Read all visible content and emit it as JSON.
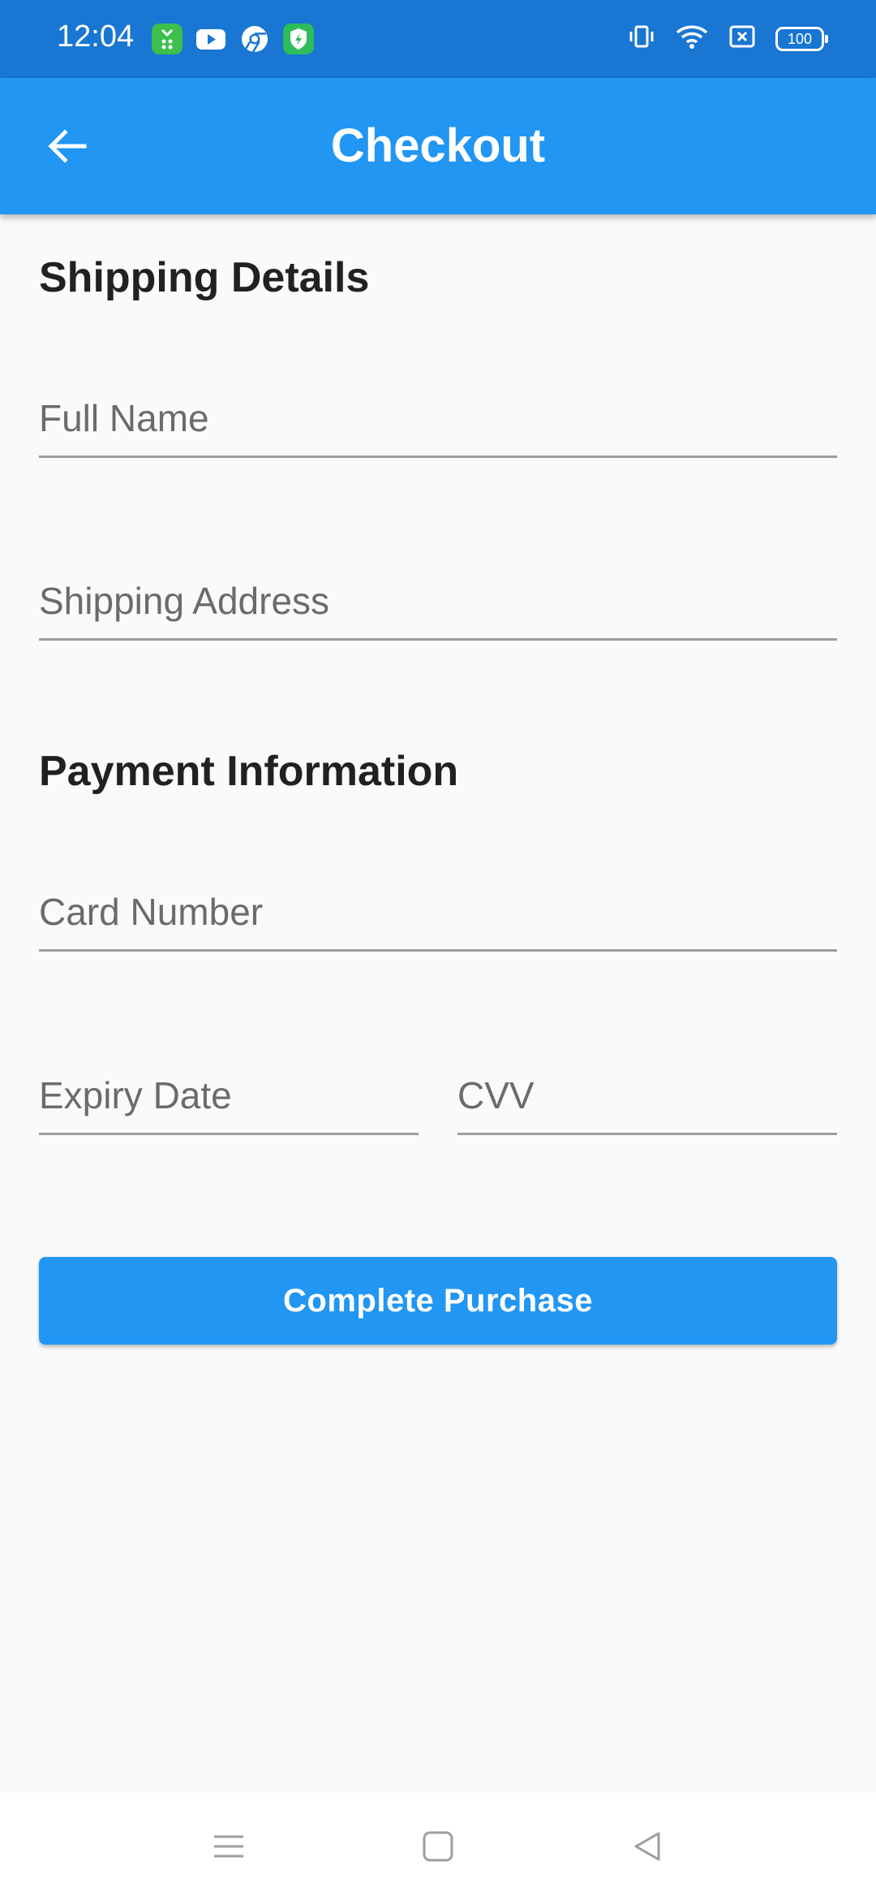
{
  "status_bar": {
    "time": "12:04",
    "battery": "100",
    "icons": [
      "app-icon-green",
      "youtube-icon",
      "chrome-icon",
      "shield-app-icon",
      "vibrate-icon",
      "wifi-icon",
      "sim-off-icon",
      "battery-icon"
    ]
  },
  "app_bar": {
    "title": "Checkout",
    "back_icon": "arrow-back-icon",
    "color": "#2196F3"
  },
  "shipping": {
    "title": "Shipping Details",
    "full_name": {
      "placeholder": "Full Name",
      "value": ""
    },
    "address": {
      "placeholder": "Shipping Address",
      "value": ""
    }
  },
  "payment": {
    "title": "Payment Information",
    "card_number": {
      "placeholder": "Card Number",
      "value": ""
    },
    "expiry": {
      "placeholder": "Expiry Date",
      "value": ""
    },
    "cvv": {
      "placeholder": "CVV",
      "value": ""
    }
  },
  "actions": {
    "complete_label": "Complete Purchase"
  },
  "nav_bar": {
    "icons": [
      "menu-icon",
      "home-square-icon",
      "back-triangle-icon"
    ]
  }
}
